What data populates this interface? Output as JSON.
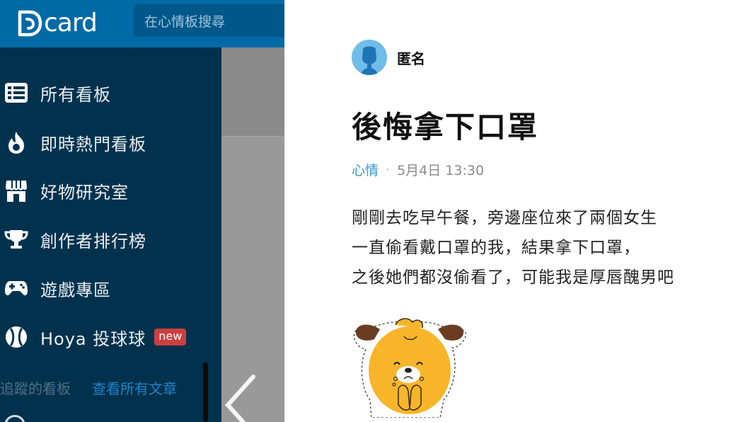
{
  "app": {
    "brand": "card",
    "search_placeholder": "在心情板搜尋"
  },
  "sidebar": {
    "items": [
      {
        "label": "所有看板",
        "icon": "list-icon"
      },
      {
        "label": "即時熱門看板",
        "icon": "flame-icon"
      },
      {
        "label": "好物研究室",
        "icon": "store-icon"
      },
      {
        "label": "創作者排行榜",
        "icon": "trophy-icon"
      },
      {
        "label": "遊戲專區",
        "icon": "gamepad-icon"
      },
      {
        "label": "Hoya 投球球",
        "icon": "baseball-icon",
        "badge": "new"
      }
    ],
    "followed_label": "追蹤的看板",
    "view_all_label": "查看所有文章"
  },
  "post": {
    "author": "匿名",
    "title": "後悔拿下口罩",
    "forum": "心情",
    "separator": "·",
    "time": "5月4日 13:30",
    "body": [
      "剛剛去吃早午餐，旁邊座位來了兩個女生",
      "一直偷看戴口罩的我，結果拿下口罩，",
      "之後她們都沒偷看了，可能我是厚唇醜男吧"
    ]
  },
  "colors": {
    "topbar": "#006aa6",
    "sidebar_bg": "#00324e",
    "link": "#1e84c7",
    "badge": "#cc3f3f",
    "forum_link": "#3397cf"
  }
}
